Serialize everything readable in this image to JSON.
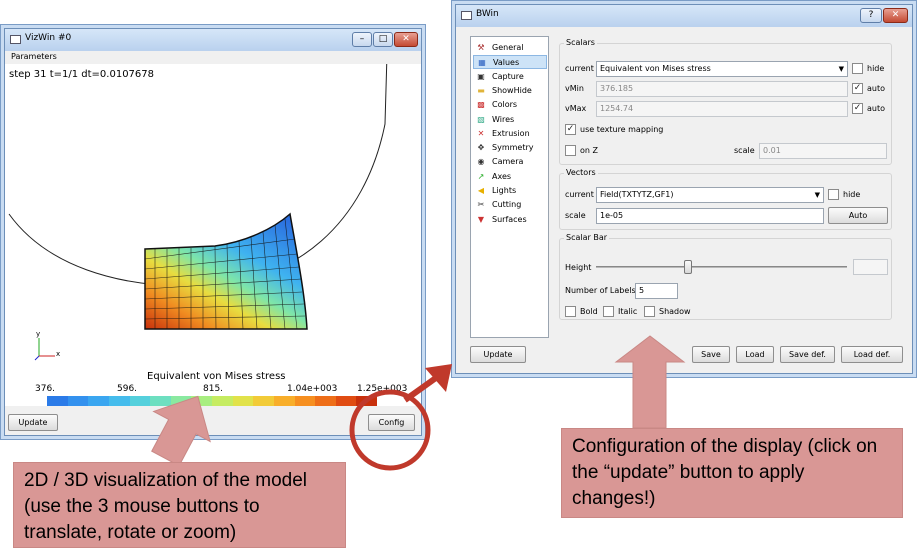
{
  "vizwin": {
    "title": "VizWin #0",
    "menu_parameters": "Parameters",
    "step_text": "step 31  t=1/1  dt=0.0107678",
    "axis_y": "y",
    "axis_x": "x",
    "colorbar_title": "Equivalent von Mises stress",
    "colorbar_ticks": [
      "376.",
      "596.",
      "815.",
      "1.04e+003",
      "1.25e+003"
    ],
    "colorbar_colors": [
      "#2b7be8",
      "#3391ee",
      "#3aa6f0",
      "#45bcec",
      "#55d0dc",
      "#6ddfc0",
      "#8ae9a0",
      "#a8ee80",
      "#c6ec62",
      "#e1e24a",
      "#f2cb38",
      "#f8ae2a",
      "#f68f20",
      "#ee6e18",
      "#e04c12",
      "#c8300c"
    ],
    "update_label": "Update",
    "config_label": "Config"
  },
  "bwin": {
    "title": "BWin",
    "help_label": "?",
    "nav": [
      {
        "label": "General",
        "icon": "general-icon"
      },
      {
        "label": "Values",
        "icon": "values-icon"
      },
      {
        "label": "Capture",
        "icon": "capture-icon"
      },
      {
        "label": "ShowHide",
        "icon": "folder-icon"
      },
      {
        "label": "Colors",
        "icon": "colors-icon"
      },
      {
        "label": "Wires",
        "icon": "wires-icon"
      },
      {
        "label": "Extrusion",
        "icon": "extrusion-icon"
      },
      {
        "label": "Symmetry",
        "icon": "symmetry-icon"
      },
      {
        "label": "Camera",
        "icon": "camera-icon"
      },
      {
        "label": "Axes",
        "icon": "axes-icon"
      },
      {
        "label": "Lights",
        "icon": "lights-icon"
      },
      {
        "label": "Cutting",
        "icon": "cutting-icon"
      },
      {
        "label": "Surfaces",
        "icon": "surfaces-icon"
      }
    ],
    "scalars": {
      "title": "Scalars",
      "current_label": "current",
      "current_value": "Equivalent von Mises stress",
      "hide_label": "hide",
      "vmin_label": "vMin",
      "vmin_value": "376.185",
      "vmax_label": "vMax",
      "vmax_value": "1254.74",
      "auto_label": "auto",
      "texture_label": "use texture mapping",
      "onz_label": "on Z",
      "scale_label": "scale",
      "scale_value": "0.01"
    },
    "vectors": {
      "title": "Vectors",
      "current_label": "current",
      "current_value": "Field(TXTYTZ,GF1)",
      "hide_label": "hide",
      "scale_label": "scale",
      "scale_value": "1e-05",
      "auto_button": "Auto"
    },
    "scalarbar": {
      "title": "Scalar Bar",
      "height_label": "Height",
      "labels_label": "Number of Labels",
      "labels_value": "5",
      "bold_label": "Bold",
      "italic_label": "Italic",
      "shadow_label": "Shadow"
    },
    "update_label": "Update",
    "save_label": "Save",
    "load_label": "Load",
    "save_def_label": "Save def.",
    "load_def_label": "Load def."
  },
  "callouts": {
    "left": "2D / 3D visualization  of the model (use the 3 mouse buttons to translate, rotate or zoom)",
    "right": "Configuration of the display (click on the “update” button to apply changes!)"
  },
  "annotation_colors": {
    "callout": "#d99795",
    "arrow": "#c0392b"
  }
}
